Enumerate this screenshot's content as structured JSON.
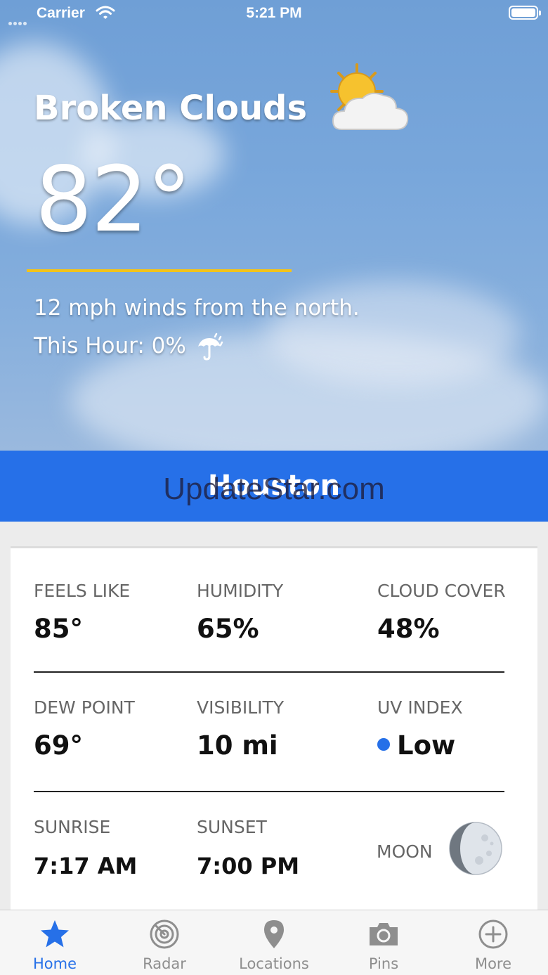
{
  "status_bar": {
    "carrier": "Carrier",
    "time": "5:21 PM"
  },
  "current": {
    "condition": "Broken Clouds",
    "condition_icon": "sun-behind-cloud-icon",
    "temperature": "82°",
    "wind": "12 mph winds from the north.",
    "precip_this_hour": "This Hour: 0%",
    "precip_icon": "umbrella-rain-icon"
  },
  "city": {
    "name": "Houston"
  },
  "watermark": "UpdateStar.com",
  "details": {
    "feels_like": {
      "label": "FEELS LIKE",
      "value": "85°"
    },
    "humidity": {
      "label": "HUMIDITY",
      "value": "65%"
    },
    "cloud_cover": {
      "label": "CLOUD COVER",
      "value": "48%"
    },
    "dew_point": {
      "label": "DEW POINT",
      "value": "69°"
    },
    "visibility": {
      "label": "VISIBILITY",
      "value": "10 mi"
    },
    "uv_index": {
      "label": "UV INDEX",
      "value": "Low",
      "color": "#2670e8"
    },
    "sunrise": {
      "label": "SUNRISE",
      "value": "7:17 AM"
    },
    "sunset": {
      "label": "SUNSET",
      "value": "7:00 PM"
    },
    "moon": {
      "label": "MOON",
      "icon": "moon-phase-icon"
    }
  },
  "tabs": [
    {
      "label": "Home",
      "icon": "star-icon",
      "active": true
    },
    {
      "label": "Radar",
      "icon": "radar-icon",
      "active": false
    },
    {
      "label": "Locations",
      "icon": "location-pin-icon",
      "active": false
    },
    {
      "label": "Pins",
      "icon": "camera-icon",
      "active": false
    },
    {
      "label": "More",
      "icon": "plus-circle-icon",
      "active": false
    }
  ],
  "colors": {
    "accent": "#2670e8",
    "rule": "#f2c31b",
    "inactive_tab": "#8e8e8e"
  }
}
